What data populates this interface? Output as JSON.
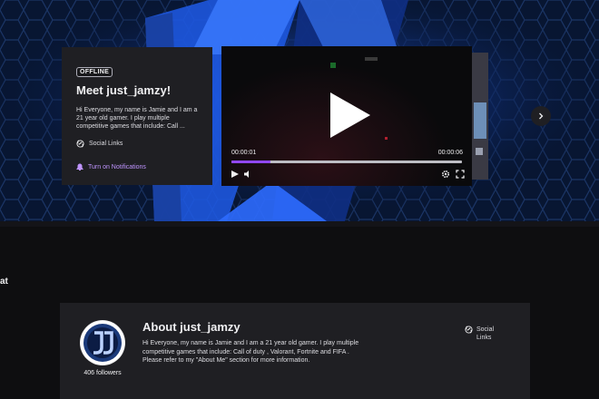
{
  "card": {
    "badge": "OFFLINE",
    "title": "Meet just_jamzy!",
    "description": "Hi Everyone, my name is Jamie and I am a 21 year old gamer. I play multiple competitive games that include: Call ...",
    "social_links_label": "Social Links",
    "notifications_label": "Turn on Notifications"
  },
  "video": {
    "current_time": "00:00:01",
    "duration": "00:00:06",
    "progress_fraction": 0.17
  },
  "edge_text": "at",
  "about": {
    "title": "About just_jamzy",
    "followers": "406 followers",
    "description": "Hi Everyone, my name is Jamie and I am a 21 year old gamer. I play multiple competitive games that include: Call of duty , Valorant, Fortnite and FIFA . Please refer to my \"About Me\" section for more information.",
    "social_links_label": "Social Links"
  },
  "colors": {
    "accent": "#9147ff",
    "card_bg": "#1f1f23",
    "page_bg": "#0e0e10",
    "banner_blue": "#1f5fe0"
  }
}
